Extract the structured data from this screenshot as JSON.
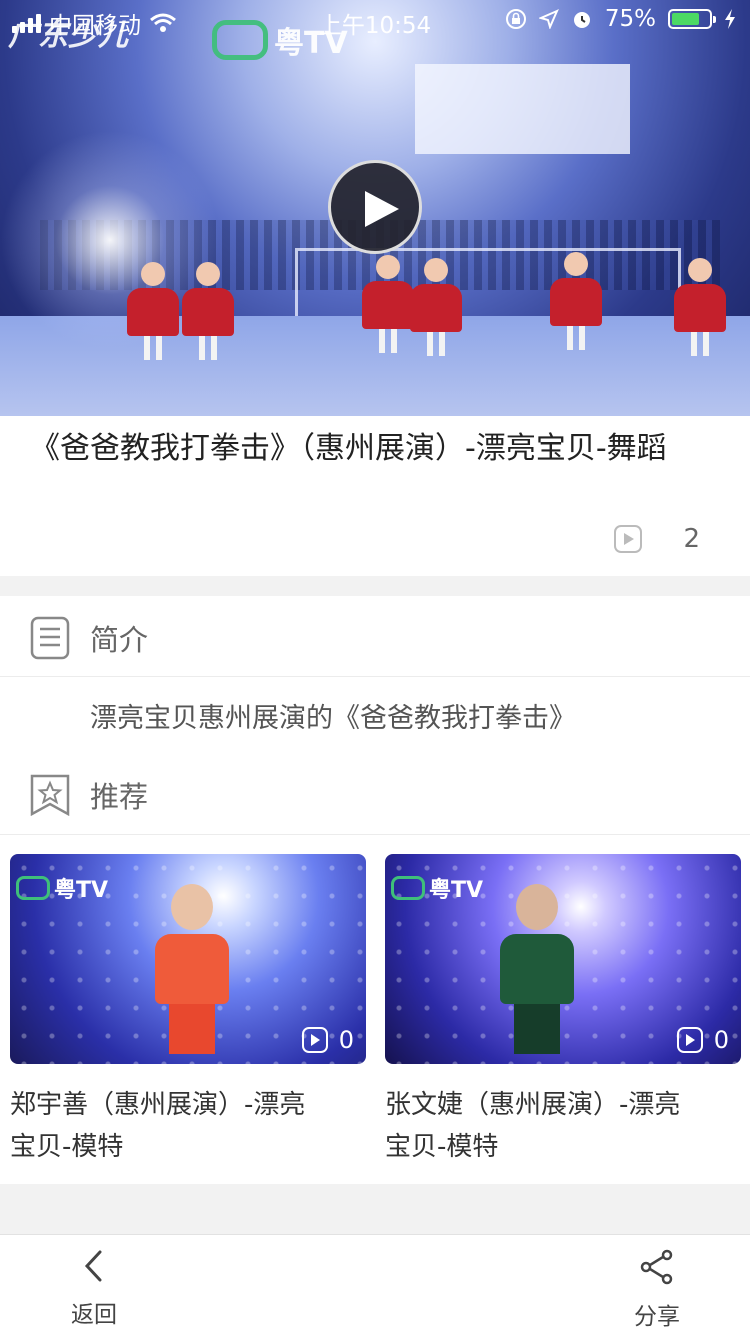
{
  "status_bar": {
    "carrier": "中国移动",
    "time": "上午10:54",
    "battery_percent": "75%",
    "battery_level": 0.75,
    "icons": [
      "signal-icon",
      "wifi-icon",
      "rotation-lock-icon",
      "location-icon",
      "alarm-icon",
      "battery-icon",
      "charging-icon"
    ]
  },
  "video": {
    "channel_logo": "广东少儿",
    "watermark": "粤TV",
    "play_icon": "play-icon"
  },
  "title_card": {
    "title": "《爸爸教我打拳击》（惠州展演）-漂亮宝贝-舞蹈",
    "play_count": "2"
  },
  "intro": {
    "heading": "简介",
    "text": "漂亮宝贝惠州展演的《爸爸教我打拳击》"
  },
  "recommend": {
    "heading": "推荐",
    "items": [
      {
        "title": "郑宇善（惠州展演）-漂亮宝贝-模特",
        "count": "0",
        "watermark": "粤TV"
      },
      {
        "title": "张文婕（惠州展演）-漂亮宝贝-模特",
        "count": "0",
        "watermark": "粤TV"
      }
    ]
  },
  "bottom_bar": {
    "back_label": "返回",
    "share_label": "分享"
  },
  "colors": {
    "accent_green": "#3fbf7a",
    "battery_green": "#4cd964",
    "text_dark": "#222222",
    "text_gray": "#666666"
  }
}
